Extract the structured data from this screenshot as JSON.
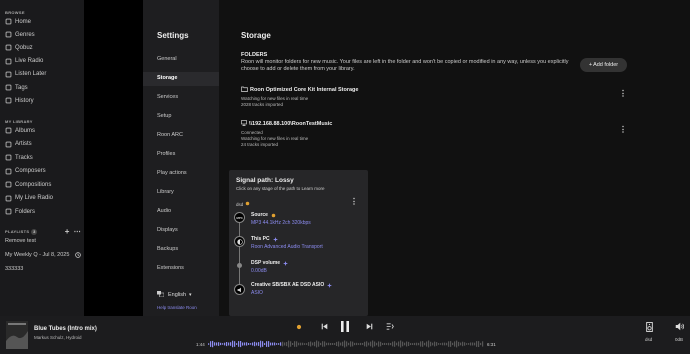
{
  "sidebar": {
    "browse_heading": "BROWSE",
    "browse_items": [
      {
        "label": "Home",
        "icon": "home-icon"
      },
      {
        "label": "Genres",
        "icon": "genres-icon"
      },
      {
        "label": "Qobuz",
        "icon": "qobuz-icon"
      },
      {
        "label": "Live Radio",
        "icon": "radio-icon"
      },
      {
        "label": "Listen Later",
        "icon": "listen-later-icon"
      },
      {
        "label": "Tags",
        "icon": "tag-icon"
      },
      {
        "label": "History",
        "icon": "history-icon"
      }
    ],
    "library_heading": "MY LIBRARY",
    "library_items": [
      {
        "label": "Albums",
        "icon": "album-icon"
      },
      {
        "label": "Artists",
        "icon": "artist-icon"
      },
      {
        "label": "Tracks",
        "icon": "track-icon"
      },
      {
        "label": "Composers",
        "icon": "composer-icon"
      },
      {
        "label": "Compositions",
        "icon": "composition-icon"
      },
      {
        "label": "My Live Radio",
        "icon": "my-radio-icon"
      },
      {
        "label": "Folders",
        "icon": "folder-icon"
      }
    ],
    "playlists_heading": "PLAYLISTS",
    "playlists_count": "3",
    "playlists": [
      "Remove test",
      "My Weekly Q - Jul 8, 2025",
      "333333"
    ]
  },
  "settings_nav": {
    "title": "Settings",
    "items": [
      "General",
      "Storage",
      "Services",
      "Setup",
      "Roon ARC",
      "Profiles",
      "Play actions",
      "Library",
      "Audio",
      "Displays",
      "Backups",
      "Extensions"
    ],
    "active": "Storage",
    "language": "English",
    "help_link": "Help translate Roon"
  },
  "storage": {
    "title": "Storage",
    "folders_heading": "FOLDERS",
    "folders_description": "Roon will monitor folders for new music. Your files are left in the folder and won't be copied or modified in any way, unless you explicitly choose to add or delete them from your library.",
    "add_folder_label": "Add folder",
    "folders": [
      {
        "name": "Roon Optimized Core Kit Internal Storage",
        "status": "Watching for new files in real time",
        "count": "2028 tracks imported"
      },
      {
        "name": "\\\\192.168.88.100\\RoonTestMusic",
        "status_lines": [
          "Connected",
          "Watching for new files in real time"
        ],
        "count": "24 tracks imported"
      }
    ]
  },
  "signal_path": {
    "title": "Signal path: Lossy",
    "subtitle": "Click on any stage of the path to Learn more",
    "zone": "dsd",
    "stages": [
      {
        "label": "Source",
        "value": "MP3 44.1kHz 2ch 320kbps"
      },
      {
        "label": "This PC",
        "value": "Roon Advanced Audio Transport"
      },
      {
        "label": "DSP volume",
        "value": "0.00dB"
      },
      {
        "label": "Creative SB/SBX AE DSD ASIO",
        "value": "ASIO"
      }
    ],
    "colors": {
      "lossy_dot": "#e0a030",
      "accent": "#8c8cf0"
    }
  },
  "player": {
    "track_title": "Blue Tubes (Intro mix)",
    "artist": "Markus Schulz, Hydroid",
    "elapsed": "1:44",
    "duration": "6:31",
    "progress_fraction": 0.266,
    "zone_name": "dsd",
    "volume": "0dB"
  }
}
